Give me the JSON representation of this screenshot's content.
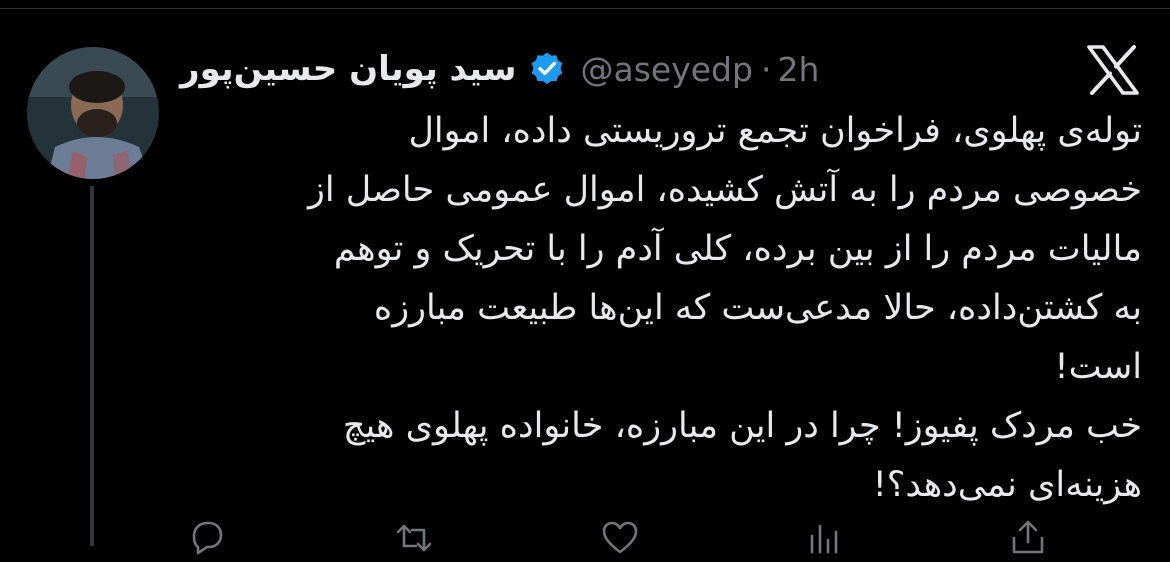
{
  "tweet": {
    "display_name": "سید پویان حسین‌پور",
    "handle": "@aseyedp",
    "separator": "·",
    "time": "2h",
    "verified": true,
    "lines": [
      "توله‌ی پهلوی، فراخوان تجمع تروریستی داده، اموال",
      "خصوصی مردم را به آتش کشیده، اموال عمومی حاصل از",
      "مالیات مردم را از بین برده، کلی آدم را با تحریک و توهم",
      "به کشتن‌داده، حالا مدعی‌ست که این‌ها طبیعت مبارزه",
      "است!",
      "خب مردک پفیوز! چرا در این مبارزه، خانواده پهلوی هیچ",
      "هزینه‌ای نمی‌دهد؟!"
    ]
  },
  "colors": {
    "background": "#000000",
    "text": "#e7e9ea",
    "muted": "#71767b",
    "verified": "#1d9bf0",
    "divider": "#2f3336",
    "thread_line": "#333639"
  },
  "icons": {
    "logo": "x-logo-icon",
    "verified": "verified-badge-icon",
    "reply": "reply-icon",
    "repost": "repost-icon",
    "like": "like-icon",
    "views": "views-icon",
    "share": "share-icon"
  }
}
